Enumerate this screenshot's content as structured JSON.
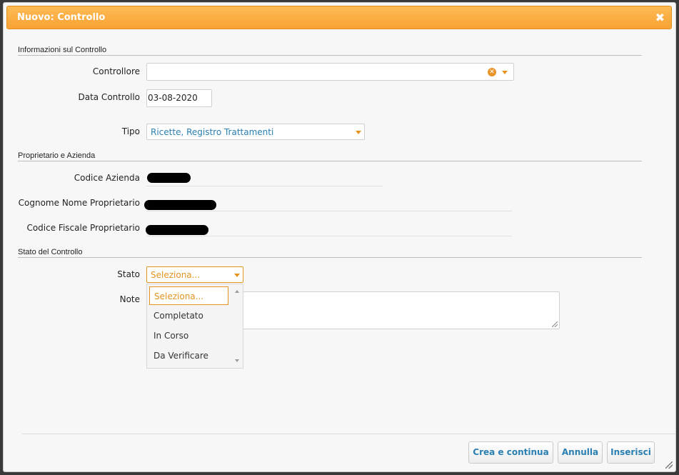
{
  "dialog": {
    "title": "Nuovo: Controllo",
    "close_glyph": "✖"
  },
  "sections": {
    "info": "Informazioni sul Controllo",
    "owner": "Proprietario e Azienda",
    "status": "Stato del Controllo"
  },
  "fields": {
    "controllore": {
      "label": "Controllore",
      "value": ""
    },
    "data_controllo": {
      "label": "Data Controllo",
      "value": "03-08-2020"
    },
    "tipo": {
      "label": "Tipo",
      "value": "Ricette, Registro Trattamenti"
    },
    "codice_azienda": {
      "label": "Codice Azienda"
    },
    "cognome_nome": {
      "label": "Cognome Nome Proprietario"
    },
    "codice_fiscale": {
      "label": "Codice Fiscale Proprietario"
    },
    "stato": {
      "label": "Stato",
      "value": "Seleziona..."
    },
    "note": {
      "label": "Note",
      "value": ""
    }
  },
  "stato_options": [
    "Seleziona...",
    "Completato",
    "In Corso",
    "Da Verificare"
  ],
  "buttons": {
    "crea_continua": "Crea e continua",
    "annulla": "Annulla",
    "inserisci": "Inserisci"
  },
  "colors": {
    "accent": "#f7a233",
    "link": "#2a7fb2",
    "select_orange": "#e5931f"
  },
  "icons": {
    "clear": "clear-icon",
    "caret": "chevron-down-icon",
    "close": "close-icon"
  }
}
